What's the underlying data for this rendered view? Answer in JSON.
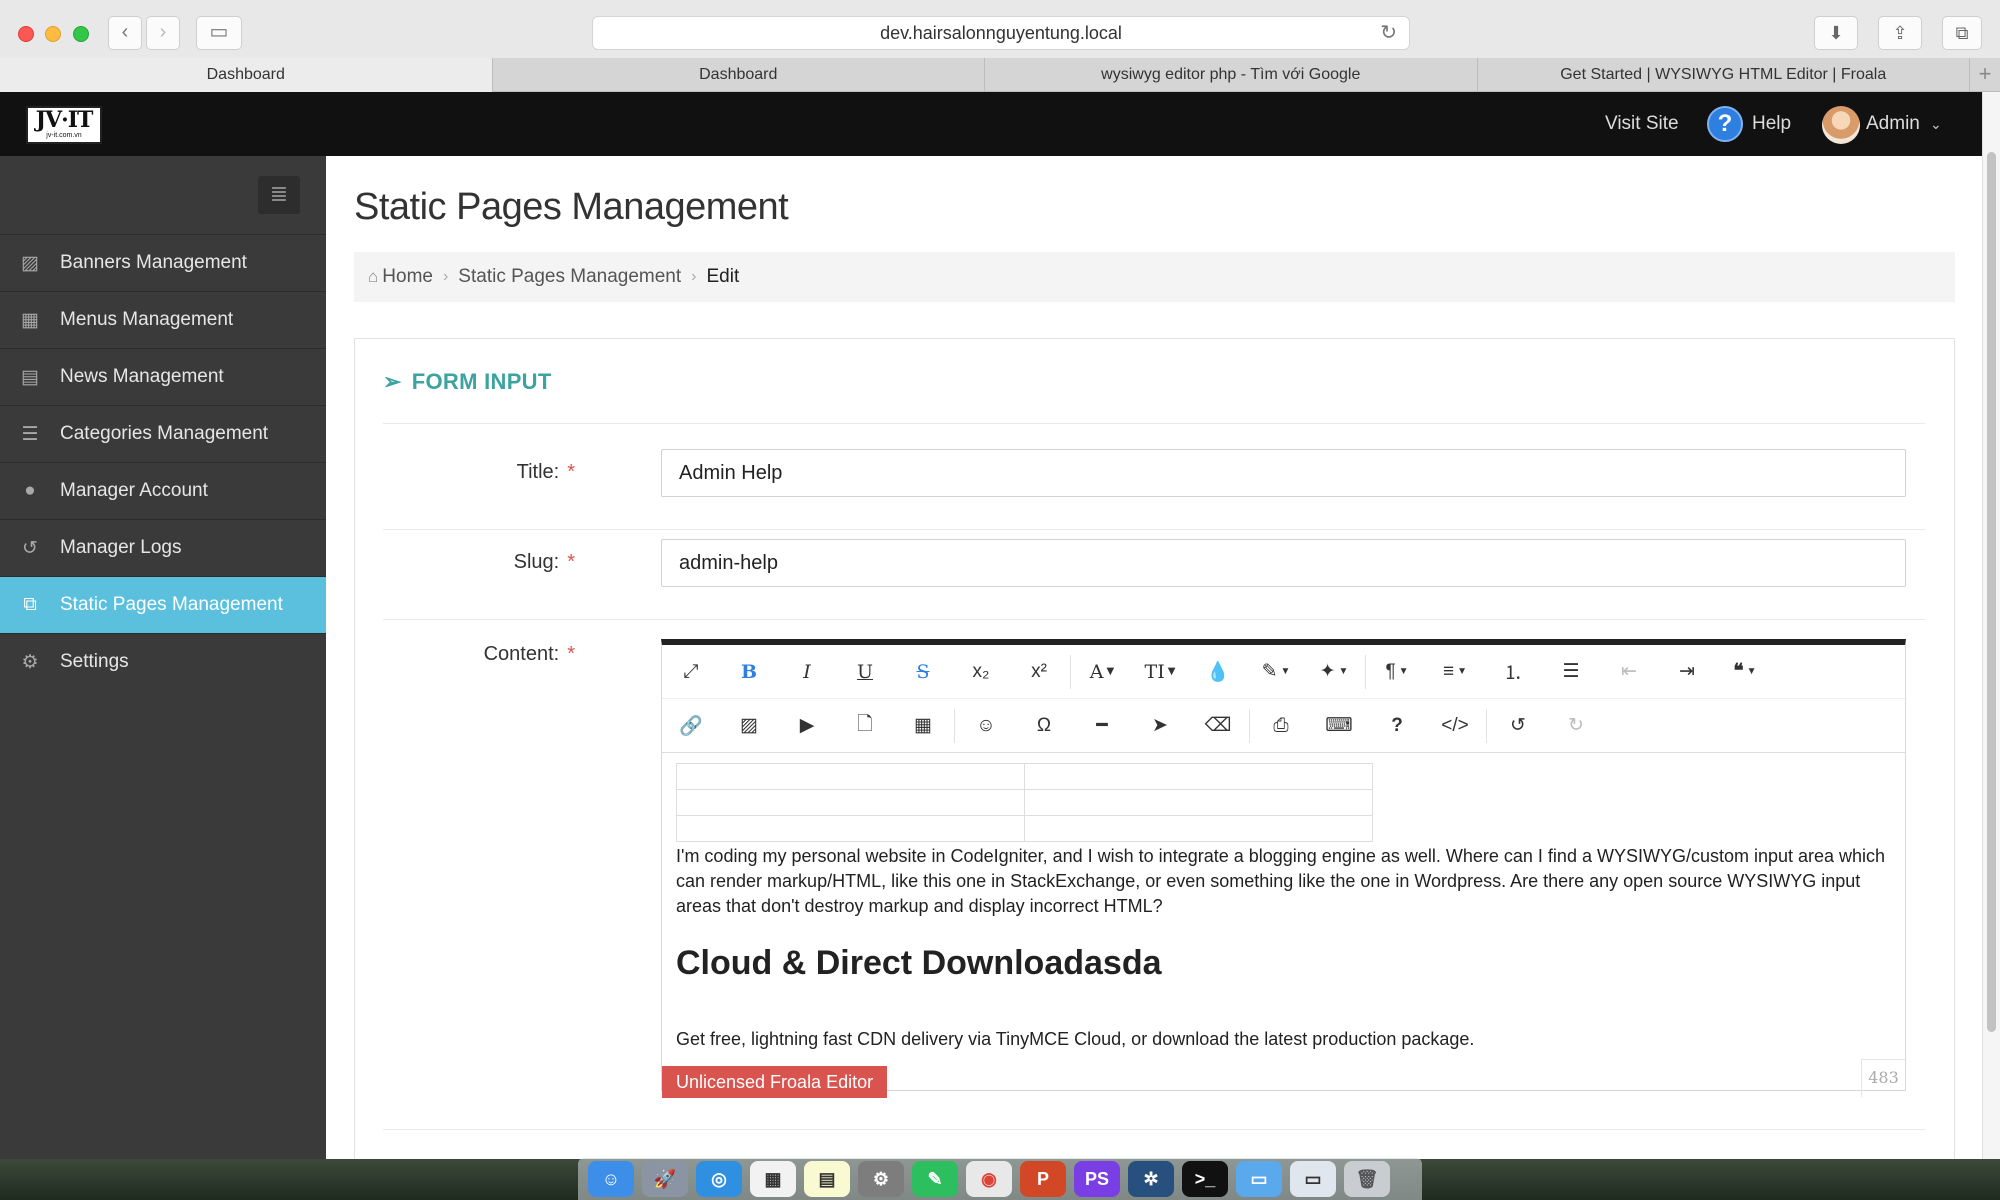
{
  "browser": {
    "url": "dev.hairsalonnguyentung.local",
    "tabs": [
      {
        "label": "Dashboard"
      },
      {
        "label": "Dashboard"
      },
      {
        "label": "wysiwyg editor php - Tìm với Google"
      },
      {
        "label": "Get Started | WYSIWYG HTML Editor | Froala"
      }
    ]
  },
  "header": {
    "logo_main": "JV·IT",
    "logo_sub": "jv-it.com.vn",
    "visit_site": "Visit Site",
    "help_icon_glyph": "?",
    "help": "Help",
    "user": "Admin"
  },
  "sidebar": {
    "items": [
      {
        "label": "Banners Management",
        "icon": "image-icon"
      },
      {
        "label": "Menus Management",
        "icon": "windows-icon"
      },
      {
        "label": "News Management",
        "icon": "newspaper-icon"
      },
      {
        "label": "Categories Management",
        "icon": "list-icon"
      },
      {
        "label": "Manager Account",
        "icon": "user-icon"
      },
      {
        "label": "Manager Logs",
        "icon": "history-icon"
      },
      {
        "label": "Static Pages Management",
        "icon": "pages-icon",
        "active": true
      },
      {
        "label": "Settings",
        "icon": "gear-icon"
      }
    ]
  },
  "main": {
    "page_title": "Static Pages Management",
    "breadcrumb": {
      "home": "Home",
      "section": "Static Pages Management",
      "current": "Edit"
    },
    "form": {
      "heading": "FORM INPUT",
      "required_mark": "*",
      "title_label": "Title:",
      "title_value": "Admin Help",
      "slug_label": "Slug:",
      "slug_value": "admin-help",
      "content_label": "Content:"
    },
    "editor": {
      "paragraph": "I'm coding my personal website in CodeIgniter, and I wish to integrate a blogging engine as well. Where can I find a WYSIWYG/custom input area which can render markup/HTML, like this one in StackExchange, or even something like the one in Wordpress. Are there any open source WYSIWYG input areas that don't destroy markup and display incorrect HTML?",
      "heading": "Cloud & Direct Downloadasda",
      "paragraph2": "Get free, lightning fast CDN delivery via TinyMCE Cloud, or download the latest production package.",
      "unlicensed": "Unlicensed Froala Editor",
      "char_count": "483"
    }
  },
  "colors": {
    "accent_teal": "#3ca3a0",
    "sidebar_active": "#5bc0de",
    "required_red": "#d9534f",
    "save_green": "#4cae4c"
  }
}
